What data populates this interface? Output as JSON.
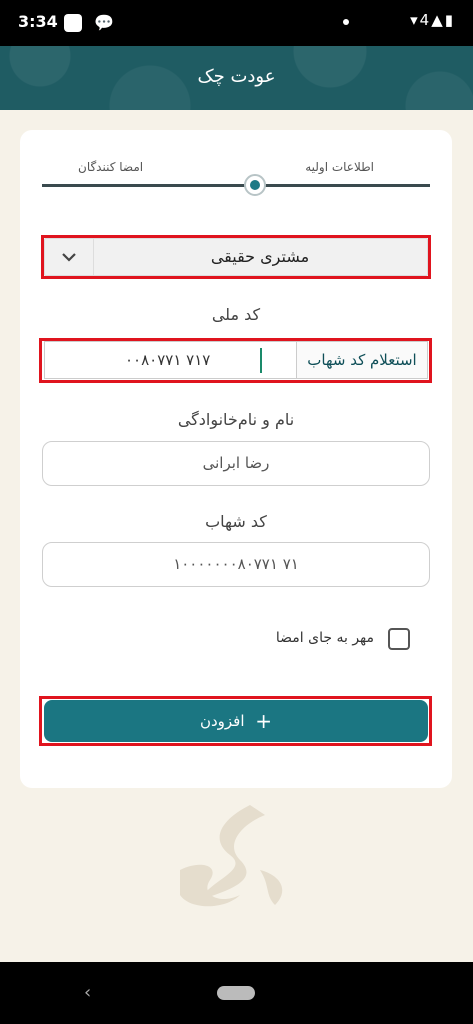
{
  "status_bar": {
    "time": "3:34",
    "right_icons": "▾4▲▮"
  },
  "header": {
    "title": "عودت چک"
  },
  "steps": [
    {
      "label": "اطلاعات اولیه"
    },
    {
      "label": "امضا کنندگان"
    }
  ],
  "customer_type": {
    "selected": "مشتری حقیقی"
  },
  "national_code": {
    "label": "کد ملی",
    "value": "۰۰۸۰۷۷۱ ۷۱۷",
    "inquiry_button": "استعلام کد شهاب"
  },
  "full_name": {
    "label": "نام و نام‌خانوادگی",
    "value": "رضا ابرانی"
  },
  "shahab_code": {
    "label": "کد شهاب",
    "value": "۱۰۰۰۰۰۰۰۸۰۷۷۱ ۷۱"
  },
  "stamp_checkbox": {
    "label": "مهر به جای امضا",
    "checked": false
  },
  "add_button": {
    "label": "افزودن",
    "icon": "+"
  },
  "colors": {
    "primary": "#1b7682",
    "header": "#1f5c63",
    "highlight": "#e0141e"
  }
}
